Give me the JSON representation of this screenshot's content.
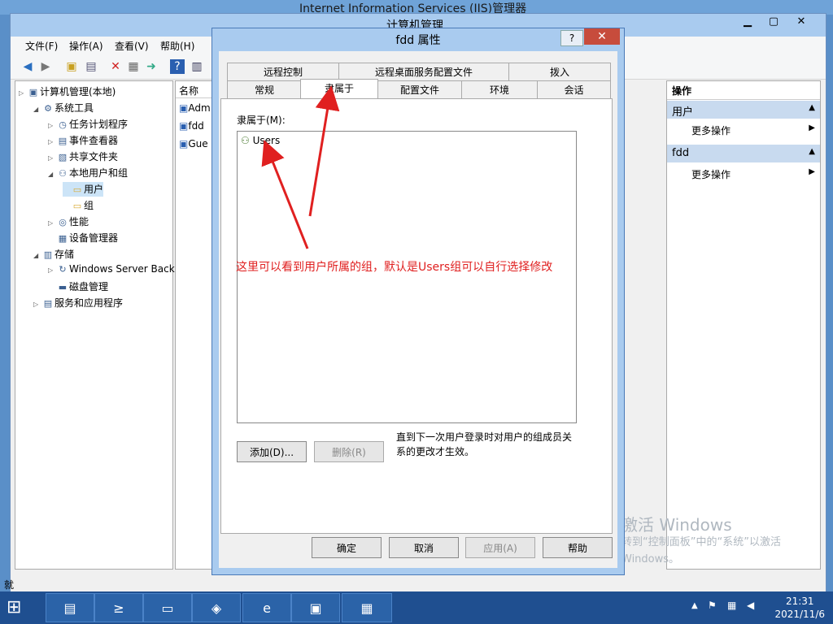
{
  "iis_window": {
    "title": "Internet Information Services (IIS)管理器"
  },
  "comp_mgmt": {
    "title": "计算机管理",
    "menu": [
      "文件(F)",
      "操作(A)",
      "查看(V)",
      "帮助(H)"
    ],
    "tree": [
      {
        "label": "计算机管理(本地)",
        "icon": "computer-icon",
        "level": 0
      },
      {
        "label": "系统工具",
        "icon": "tools-icon",
        "level": 1
      },
      {
        "label": "任务计划程序",
        "icon": "clock-icon",
        "level": 2
      },
      {
        "label": "事件查看器",
        "icon": "event-viewer-icon",
        "level": 2
      },
      {
        "label": "共享文件夹",
        "icon": "shared-folder-icon",
        "level": 2
      },
      {
        "label": "本地用户和组",
        "icon": "users-icon",
        "level": 2
      },
      {
        "label": "用户",
        "icon": "folder-icon",
        "level": 3
      },
      {
        "label": "组",
        "icon": "folder-icon",
        "level": 3
      },
      {
        "label": "性能",
        "icon": "performance-icon",
        "level": 2
      },
      {
        "label": "设备管理器",
        "icon": "device-manager-icon",
        "level": 2
      },
      {
        "label": "存储",
        "icon": "storage-icon",
        "level": 1
      },
      {
        "label": "Windows Server Back",
        "icon": "backup-icon",
        "level": 2
      },
      {
        "label": "磁盘管理",
        "icon": "disk-icon",
        "level": 2
      },
      {
        "label": "服务和应用程序",
        "icon": "services-icon",
        "level": 1
      }
    ],
    "list_header": "名称",
    "list_items": [
      "Adm",
      "fdd",
      "Gue"
    ],
    "actions": {
      "header": "操作",
      "sections": [
        {
          "title": "用户",
          "item": "更多操作"
        },
        {
          "title": "fdd",
          "item": "更多操作"
        }
      ]
    },
    "status_text": "就"
  },
  "dialog": {
    "title": "fdd 属性",
    "help_label": "?",
    "close_label": "✕",
    "tabs_row1": [
      "远程控制",
      "远程桌面服务配置文件",
      "拨入"
    ],
    "tabs_row2": [
      "常规",
      "隶属于",
      "配置文件",
      "环境",
      "会话"
    ],
    "member_of_label": "隶属于(M):",
    "members": [
      "Users"
    ],
    "add_button": "添加(D)...",
    "remove_button": "删除(R)",
    "note": "直到下一次用户登录时对用户的组成员关系的更改才生效。",
    "ok_button": "确定",
    "cancel_button": "取消",
    "apply_button": "应用(A)",
    "help_button": "帮助"
  },
  "annotation": "这里可以看到用户所属的组，默认是Users组可以自行选择修改",
  "watermark": {
    "line1": "激活 Windows",
    "line2": "转到“控制面板”中的“系统”以激活",
    "line3": "Windows。"
  },
  "taskbar": {
    "time": "21:31",
    "date": "2021/11/6"
  },
  "colors": {
    "accent": "#a9cbef",
    "annotation": "#e02020",
    "taskbar": "#1f4f90"
  }
}
